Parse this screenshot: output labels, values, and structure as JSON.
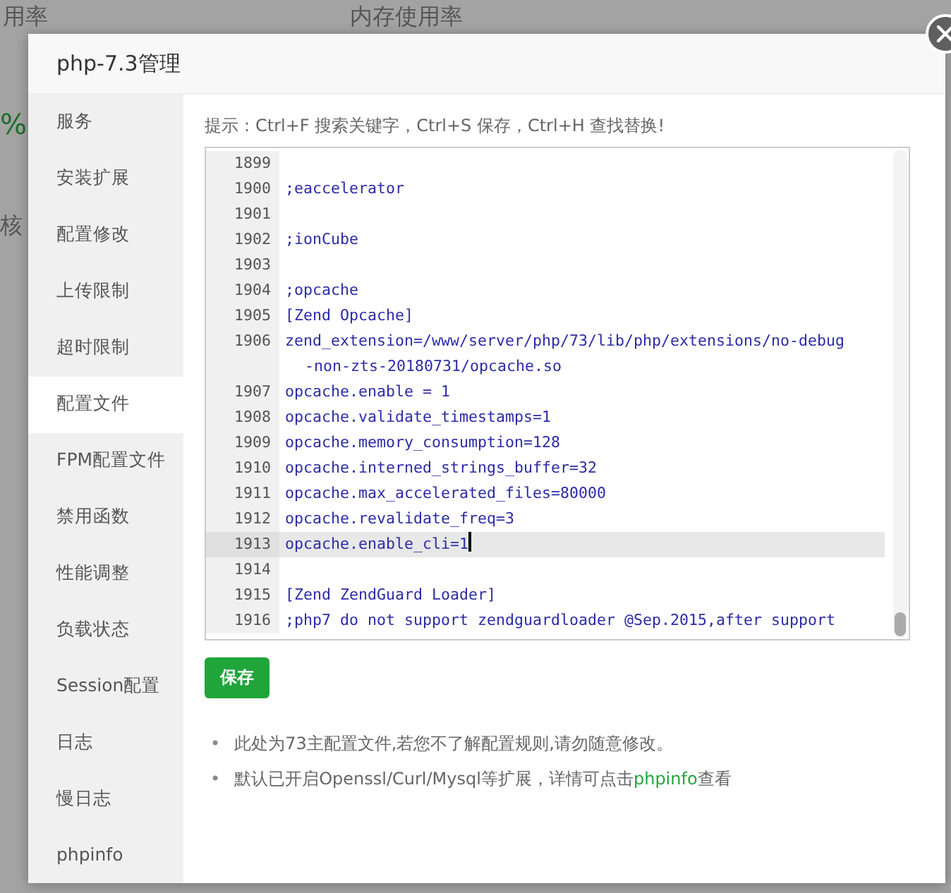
{
  "background": {
    "texts": [
      "用率",
      "内存使用率",
      "%",
      "核"
    ]
  },
  "dialog": {
    "title": "php-7.3管理"
  },
  "sidebar": {
    "items": [
      {
        "label": "服务",
        "selected": false
      },
      {
        "label": "安装扩展",
        "selected": false
      },
      {
        "label": "配置修改",
        "selected": false
      },
      {
        "label": "上传限制",
        "selected": false
      },
      {
        "label": "超时限制",
        "selected": false
      },
      {
        "label": "配置文件",
        "selected": true
      },
      {
        "label": "FPM配置文件",
        "selected": false
      },
      {
        "label": "禁用函数",
        "selected": false
      },
      {
        "label": "性能调整",
        "selected": false
      },
      {
        "label": "负载状态",
        "selected": false
      },
      {
        "label": "Session配置",
        "selected": false
      },
      {
        "label": "日志",
        "selected": false
      },
      {
        "label": "慢日志",
        "selected": false
      },
      {
        "label": "phpinfo",
        "selected": false
      }
    ]
  },
  "hint": "提示：Ctrl+F 搜索关键字，Ctrl+S 保存，Ctrl+H 查找替换!",
  "editor": {
    "lines": [
      {
        "number": "1899",
        "selected": false
      },
      {
        "number": "1900",
        "text": ";eaccelerator",
        "selected": false
      },
      {
        "number": "1901",
        "selected": false
      },
      {
        "number": "1902",
        "text": ";ionCube",
        "selected": false
      },
      {
        "number": "1903",
        "selected": false
      },
      {
        "number": "1904",
        "text": ";opcache",
        "selected": false
      },
      {
        "number": "1905",
        "text": "[Zend Opcache]",
        "selected": false
      },
      {
        "number": "1906",
        "text": "zend_extension=/www/server/php/73/lib/php/extensions/no-debug",
        "text_continued": "-non-zts-20180731/opcache.so",
        "selected": false
      },
      {
        "number": "1907",
        "text": "opcache.enable = 1",
        "selected": false
      },
      {
        "number": "1908",
        "text": "opcache.validate_timestamps=1",
        "selected": false
      },
      {
        "number": "1909",
        "text": "opcache.memory_consumption=128",
        "selected": false
      },
      {
        "number": "1910",
        "text": "opcache.interned_strings_buffer=32",
        "selected": false
      },
      {
        "number": "1911",
        "text": "opcache.max_accelerated_files=80000",
        "selected": false
      },
      {
        "number": "1912",
        "text": "opcache.revalidate_freq=3",
        "selected": false
      },
      {
        "number": "1913",
        "text": "opcache.enable_cli=1",
        "selected": true
      },
      {
        "number": "1914",
        "selected": false
      },
      {
        "number": "1915",
        "text": "[Zend ZendGuard Loader]",
        "selected": false
      },
      {
        "number": "1916",
        "text": ";php7 do not support zendguardloader @Sep.2015,after support",
        "selected": false
      }
    ]
  },
  "save_button": "保存",
  "notes": [
    {
      "marker": "•",
      "text": "此处为73主配置文件,若您不了解配置规则,请勿随意修改。"
    },
    {
      "marker": "•",
      "text": "默认已开启Openssl/Curl/Mysql等扩展，详情可点击",
      "link": "phpinfo",
      "after": "查看"
    }
  ]
}
